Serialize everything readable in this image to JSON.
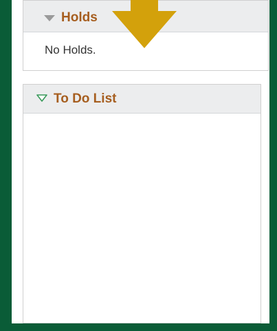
{
  "holds": {
    "title": "Holds",
    "collapse_icon": "triangle-down-gray-icon",
    "message": "No Holds."
  },
  "todo": {
    "title": "To Do List",
    "collapse_icon": "triangle-down-outline-green-icon"
  },
  "annotation": {
    "icon": "down-arrow-pointer-icon",
    "color": "#d3a10b"
  },
  "colors": {
    "background": "#0a5c37",
    "header_bg": "#ecedee",
    "title_text": "#a65e1f"
  }
}
